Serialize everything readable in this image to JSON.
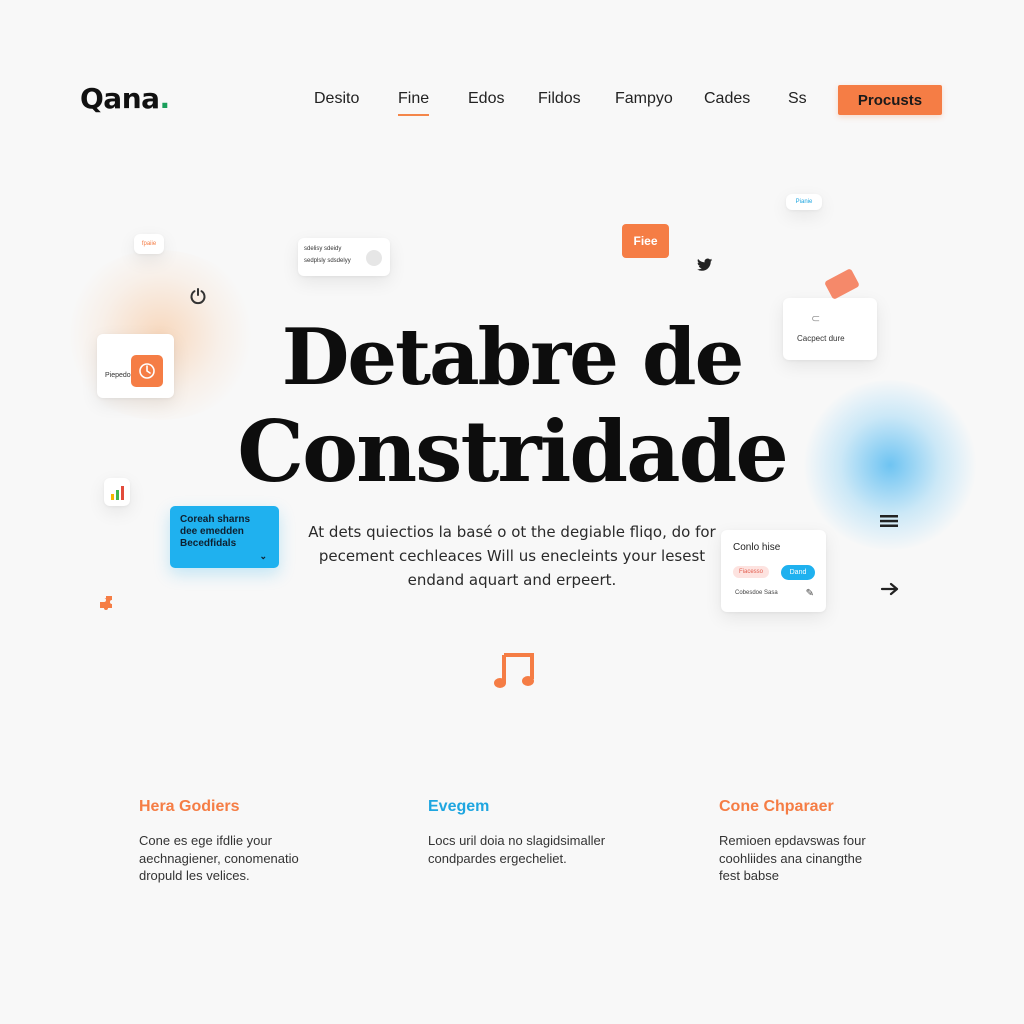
{
  "brand": {
    "name": "Qana",
    "dot": ".",
    "accent": "#f57d45",
    "blue": "#1fb1ef",
    "green": "#1a9f5b"
  },
  "nav": {
    "items": [
      {
        "label": "Desito",
        "active": false
      },
      {
        "label": "Fine",
        "active": true
      },
      {
        "label": "Edos",
        "active": false
      },
      {
        "label": "Fildos",
        "active": false
      },
      {
        "label": "Fampyo",
        "active": false
      },
      {
        "label": "Cades",
        "active": false
      },
      {
        "label": "Ss",
        "active": false
      }
    ],
    "cta": "Procusts"
  },
  "hero": {
    "title_line1": "Detabre de",
    "title_line2": "Constridade",
    "subtitle": "At dets quiectios la basé o ot the degiable fliqo, do for pecement cechleaces Will us enecleints your lesest endand aquart and erpeert."
  },
  "floating": {
    "small_tag_left": "fpaiie",
    "small_tag_right": "Pianie",
    "list_card_line1": "sdelisy sdeidy",
    "list_card_line2": "sedplsly sdsdelyy",
    "orange_pill": "Fiee",
    "left_card_label": "Piepedo",
    "right_card_label": "Cacpect dure",
    "blue_card_text": "Coreah sharns dee emedden Becedfidals",
    "form_card_title": "Conlo hise",
    "form_card_tag_red": "Fiacesso",
    "form_card_tag_blue": "Dand",
    "form_card_footer": "Cobesdoe Sasa"
  },
  "icons": [
    "twitter-icon",
    "power-icon",
    "bar-chart-icon",
    "puzzle-icon",
    "menu-icon",
    "arrow-right-icon",
    "music-note-icon",
    "pencil-icon"
  ],
  "features": [
    {
      "title": "Hera Godiers",
      "color": "#f57d45",
      "body": "Cone es ege ifdlie your aechnagiener, conomenatio dropuld les velices."
    },
    {
      "title": "Evegem",
      "color": "#1fa6e0",
      "body": "Locs uril doia no slagidsimaller condpardes ergecheliet."
    },
    {
      "title": "Cone Chparaer",
      "color": "#f57d45",
      "body": "Remioen epdavswas four coohliides ana cinangthe fest babse"
    }
  ]
}
